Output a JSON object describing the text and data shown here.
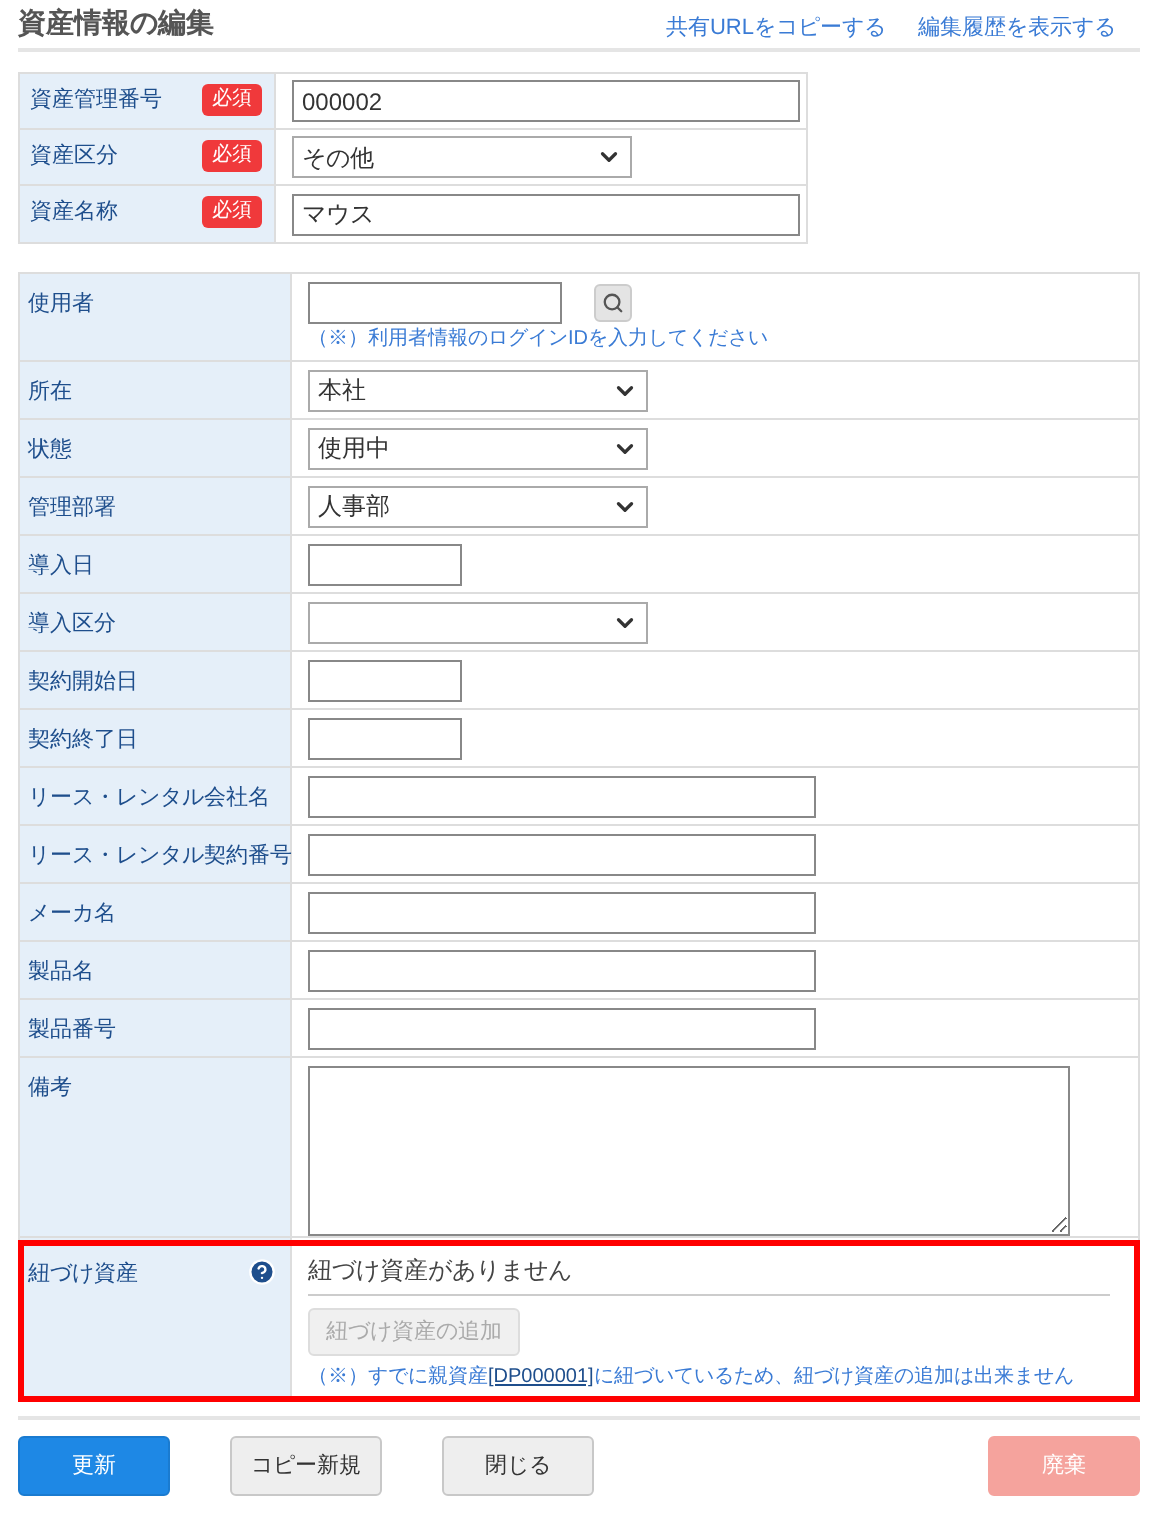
{
  "title": "資産情報の編集",
  "header_links": [
    "共有URLをコピーする",
    "編集履歴を表示する"
  ],
  "basic_fields": [
    {
      "label": "資産管理番号",
      "required": true,
      "badge": "必須",
      "kind": "text",
      "value": "000002"
    },
    {
      "label": "資産区分",
      "required": true,
      "badge": "必須",
      "kind": "select",
      "value": "その他"
    },
    {
      "label": "資産名称",
      "required": true,
      "badge": "必須",
      "kind": "text",
      "value": "マウス"
    }
  ],
  "detail_fields": [
    {
      "label": "使用者",
      "kind": "user",
      "note": "（※）利用者情報のログインIDを入力してください"
    },
    {
      "label": "所在",
      "kind": "select",
      "value": "本社"
    },
    {
      "label": "状態",
      "kind": "select",
      "value": "使用中"
    },
    {
      "label": "管理部署",
      "kind": "select",
      "value": "人事部"
    },
    {
      "label": "導入日",
      "kind": "date"
    },
    {
      "label": "導入区分",
      "kind": "select"
    },
    {
      "label": "契約開始日",
      "kind": "date"
    },
    {
      "label": "契約終了日",
      "kind": "date"
    },
    {
      "label": "リース・レンタル会社名",
      "kind": "text"
    },
    {
      "label": "リース・レンタル契約番号",
      "kind": "text"
    },
    {
      "label": "メーカ名",
      "kind": "text"
    },
    {
      "label": "製品名",
      "kind": "text"
    },
    {
      "label": "製品番号",
      "kind": "text"
    },
    {
      "label": "備考",
      "kind": "textarea"
    }
  ],
  "linked_assets": {
    "label": "紐づけ資産",
    "highlighted": true,
    "empty_text": "紐づけ資産がありません",
    "add_button": {
      "label": "紐づけ資産の追加",
      "disabled": true
    },
    "note_before": "（※）すでに親資産",
    "note_link": "[DP000001]",
    "note_after": "に紐づいているため、紐づけ資産の追加は出来ません"
  },
  "footer_buttons": [
    {
      "label": "更新",
      "kind": "primary",
      "disabled": false
    },
    {
      "label": "コピー新規",
      "kind": "secondary",
      "disabled": false
    },
    {
      "label": "閉じる",
      "kind": "secondary",
      "disabled": false
    },
    {
      "label": "廃棄",
      "kind": "danger",
      "disabled": true
    }
  ]
}
